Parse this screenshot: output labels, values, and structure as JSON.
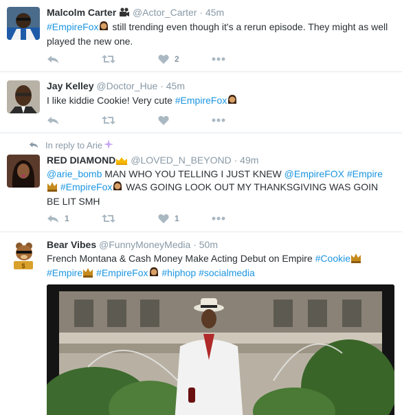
{
  "tweets": [
    {
      "name": "Malcolm Carter",
      "handle": "@Actor_Carter",
      "time": "45m",
      "text_parts": [
        "#EmpireFox",
        " still trending even though it's a rerun episode. They might as well played the new one."
      ],
      "like_count": "2",
      "reply_count": "",
      "retweet_count": ""
    },
    {
      "name": "Jay Kelley",
      "handle": "@Doctor_Hue",
      "time": "45m",
      "text_parts": [
        "I like kiddie Cookie! Very cute ",
        "#EmpireFox"
      ],
      "like_count": "",
      "reply_count": "",
      "retweet_count": ""
    },
    {
      "reply_to": "In reply to Arie",
      "name": "RED DIAMOND",
      "handle": "@LOVED_N_BEYOND",
      "time": "49m",
      "text_parts": [
        "@arie_bomb",
        " MAN WHO YOU TELLING I JUST KNEW ",
        "@EmpireFOX",
        "#Empire",
        "#EmpireFox",
        " WAS GOING LOOK OUT MY THANKSGIVING WAS GOIN BE LIT SMH"
      ],
      "reply_count": "1",
      "like_count": "1",
      "retweet_count": ""
    },
    {
      "name": "Bear Vibes",
      "handle": "@FunnyMoneyMedia",
      "time": "50m",
      "text_parts": [
        "French Montana & Cash Money Make Acting Debut on Empire ",
        "#Cookie",
        "#Empire",
        "#EmpireFox",
        "#hiphop",
        "#socialmedia"
      ]
    }
  ],
  "separator": "·",
  "icons": {
    "reply": "reply-icon",
    "retweet": "retweet-icon",
    "like": "heart-icon",
    "more": "more-icon",
    "reply_context": "reply-arrow-icon"
  },
  "colors": {
    "link": "#1b95e0",
    "meta": "#8899a6",
    "text": "#292f33",
    "border": "#e1e8ed"
  }
}
